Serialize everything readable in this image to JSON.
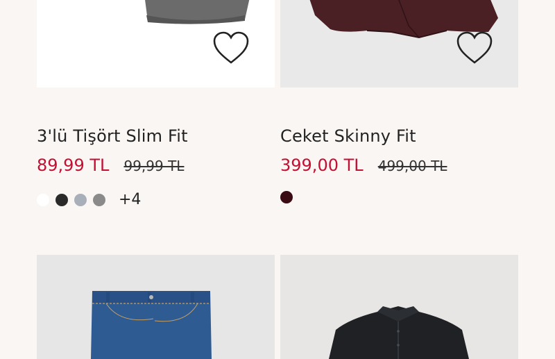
{
  "products": [
    {
      "title": "3'lü Tişört Slim Fit",
      "price": "89,99 TL",
      "old_price": "99,99 TL",
      "swatches": [
        "#ffffff",
        "#2a2a2a",
        "#a9afb8",
        "#8a8a8a"
      ],
      "more_colors": "+4"
    },
    {
      "title": "Ceket Skinny Fit",
      "price": "399,00 TL",
      "old_price": "499,00 TL",
      "swatches": [
        "#3a0b12"
      ]
    }
  ],
  "icons": {
    "wishlist": "heart-outline-icon"
  },
  "colors": {
    "background": "#f9f6f4",
    "sale_price": "#c30f32",
    "text": "#222222"
  }
}
